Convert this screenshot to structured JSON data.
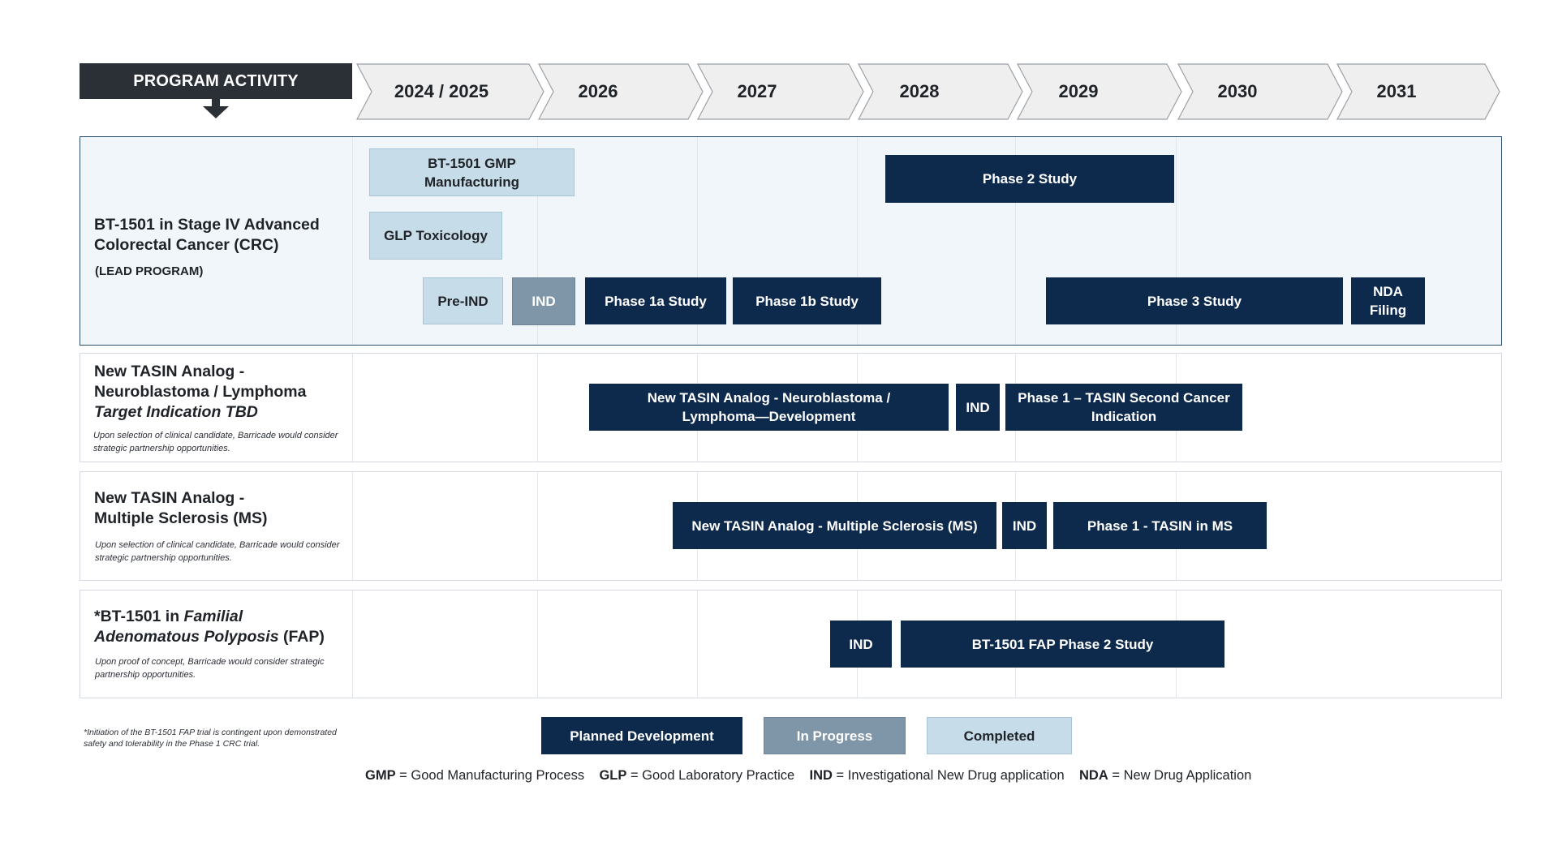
{
  "header": {
    "program_activity": "PROGRAM ACTIVITY",
    "years": [
      "2024 / 2025",
      "2026",
      "2027",
      "2028",
      "2029",
      "2030",
      "2031"
    ]
  },
  "rows": {
    "lead": {
      "title_line1": "BT-1501 in Stage IV Advanced",
      "title_line2": "Colorectal Cancer (CRC)",
      "tag": "(LEAD PROGRAM)",
      "bars": {
        "gmp_line1": "BT-1501 GMP",
        "gmp_line2": "Manufacturing",
        "glp": "GLP Toxicology",
        "pre_ind": "Pre-IND",
        "ind": "IND",
        "phase1a": "Phase 1a Study",
        "phase1b": "Phase 1b Study",
        "phase2": "Phase 2 Study",
        "phase3": "Phase 3 Study",
        "nda_line1": "NDA",
        "nda_line2": "Filing"
      }
    },
    "neuro": {
      "title_line1": "New TASIN Analog -",
      "title_line2": "Neuroblastoma / Lymphoma",
      "title_line3": "Target Indication TBD",
      "note": "Upon selection of clinical candidate, Barricade would consider strategic partnership opportunities.",
      "bars": {
        "dev_line1": "New TASIN Analog - Neuroblastoma /",
        "dev_line2": "Lymphoma—Development",
        "ind": "IND",
        "phase1_line1": "Phase 1 – TASIN Second Cancer",
        "phase1_line2": "Indication"
      }
    },
    "ms": {
      "title_line1": "New TASIN Analog -",
      "title_line2": "Multiple Sclerosis (MS)",
      "note": "Upon selection of clinical candidate, Barricade would consider strategic partnership opportunities.",
      "bars": {
        "dev": "New TASIN Analog - Multiple Sclerosis (MS)",
        "ind": "IND",
        "phase1": "Phase 1 - TASIN in MS"
      }
    },
    "fap": {
      "title_prefix": "*BT-1501 in ",
      "title_italic1": "Familial",
      "title_italic2": "Adenomatous Polyposis",
      "title_suffix": " (FAP)",
      "note": "Upon proof of concept, Barricade would consider strategic partnership opportunities.",
      "bars": {
        "ind": "IND",
        "phase2": "BT-1501 FAP Phase 2 Study"
      }
    }
  },
  "footnote": "*Initiation of the BT-1501 FAP trial is contingent upon demonstrated safety and tolerability in the Phase 1 CRC trial.",
  "legend": {
    "planned": "Planned Development",
    "progress": "In Progress",
    "completed": "Completed"
  },
  "abbreviations": [
    {
      "abbr": "GMP",
      "def": " = Good Manufacturing Process"
    },
    {
      "abbr": "GLP",
      "def": " = Good Laboratory Practice"
    },
    {
      "abbr": "IND",
      "def": " = Investigational New Drug application"
    },
    {
      "abbr": "NDA",
      "def": " = New Drug Application"
    }
  ],
  "colors": {
    "planned": "#0d2a4c",
    "in_progress": "#7f96a8",
    "completed": "#c6dce8",
    "header_dark": "#2b2f36",
    "chevron_fill": "#efefef",
    "chevron_stroke": "#9aa0a6"
  }
}
